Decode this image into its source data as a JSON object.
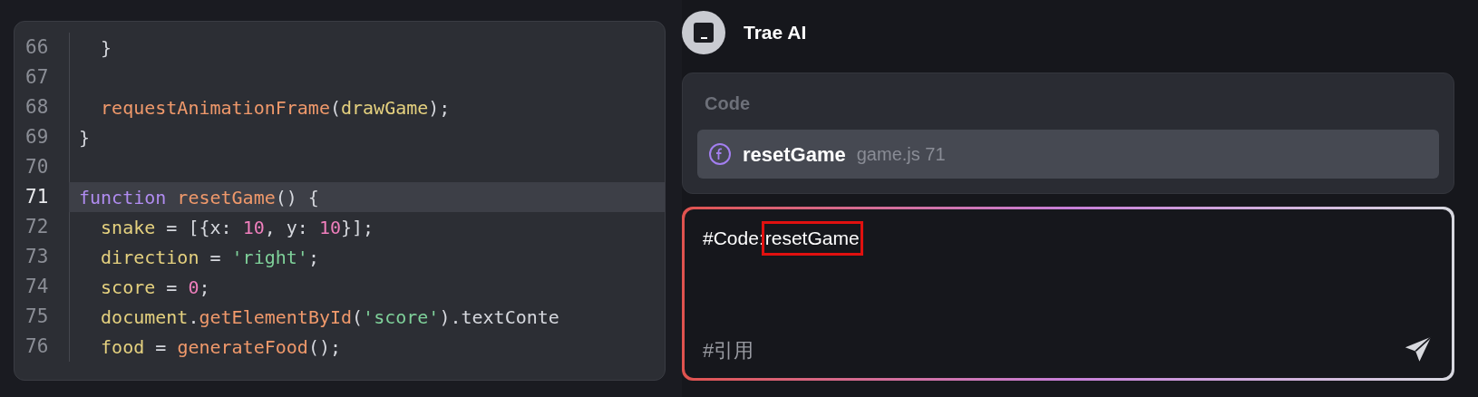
{
  "code_peek": {
    "lines": [
      {
        "number": "66",
        "current": false,
        "tokens": [
          {
            "kind": "punct",
            "text": "  }"
          }
        ]
      },
      {
        "number": "67",
        "current": false
      },
      {
        "number": "68",
        "current": false,
        "tokens": [
          {
            "kind": "fn",
            "text": "  requestAnimationFrame"
          },
          {
            "kind": "punct",
            "text": "("
          },
          {
            "kind": "var",
            "text": "drawGame"
          },
          {
            "kind": "punct",
            "text": ");"
          }
        ]
      },
      {
        "number": "69",
        "current": false,
        "tokens": [
          {
            "kind": "punct",
            "text": "}"
          }
        ]
      },
      {
        "number": "70",
        "current": false
      },
      {
        "number": "71",
        "current": true,
        "tokens": [
          {
            "kind": "kw",
            "text": "function"
          },
          {
            "kind": "fn",
            "text": " resetGame"
          },
          {
            "kind": "punct",
            "text": "() {"
          }
        ]
      },
      {
        "number": "72",
        "current": false,
        "tokens": [
          {
            "kind": "var",
            "text": "  snake"
          },
          {
            "kind": "punct",
            "text": " = [{x: "
          },
          {
            "kind": "num",
            "text": "10"
          },
          {
            "kind": "punct",
            "text": ", y: "
          },
          {
            "kind": "num",
            "text": "10"
          },
          {
            "kind": "punct",
            "text": "}];"
          }
        ]
      },
      {
        "number": "73",
        "current": false,
        "tokens": [
          {
            "kind": "var",
            "text": "  direction"
          },
          {
            "kind": "punct",
            "text": " = "
          },
          {
            "kind": "str",
            "text": "'right'"
          },
          {
            "kind": "punct",
            "text": ";"
          }
        ]
      },
      {
        "number": "74",
        "current": false,
        "tokens": [
          {
            "kind": "var",
            "text": "  score"
          },
          {
            "kind": "punct",
            "text": " = "
          },
          {
            "kind": "num",
            "text": "0"
          },
          {
            "kind": "punct",
            "text": ";"
          }
        ]
      },
      {
        "number": "75",
        "current": false,
        "tokens": [
          {
            "kind": "var",
            "text": "  document"
          },
          {
            "kind": "punct",
            "text": "."
          },
          {
            "kind": "fn",
            "text": "getElementById"
          },
          {
            "kind": "punct",
            "text": "("
          },
          {
            "kind": "str",
            "text": "'score'"
          },
          {
            "kind": "punct",
            "text": ").textConte"
          }
        ]
      },
      {
        "number": "76",
        "current": false,
        "tokens": [
          {
            "kind": "var",
            "text": "  food"
          },
          {
            "kind": "punct",
            "text": " = "
          },
          {
            "kind": "fn",
            "text": "generateFood"
          },
          {
            "kind": "punct",
            "text": "();"
          }
        ]
      }
    ]
  },
  "chat": {
    "assistant_name": "Trae AI",
    "suggestions": {
      "heading": "Code",
      "items": [
        {
          "name": "resetGame",
          "location": "game.js 71",
          "selected": true
        }
      ]
    },
    "input": {
      "value": "#Code:",
      "mention": {
        "text": "resetGame",
        "outlined": true
      },
      "reference_label": "#引用"
    }
  }
}
